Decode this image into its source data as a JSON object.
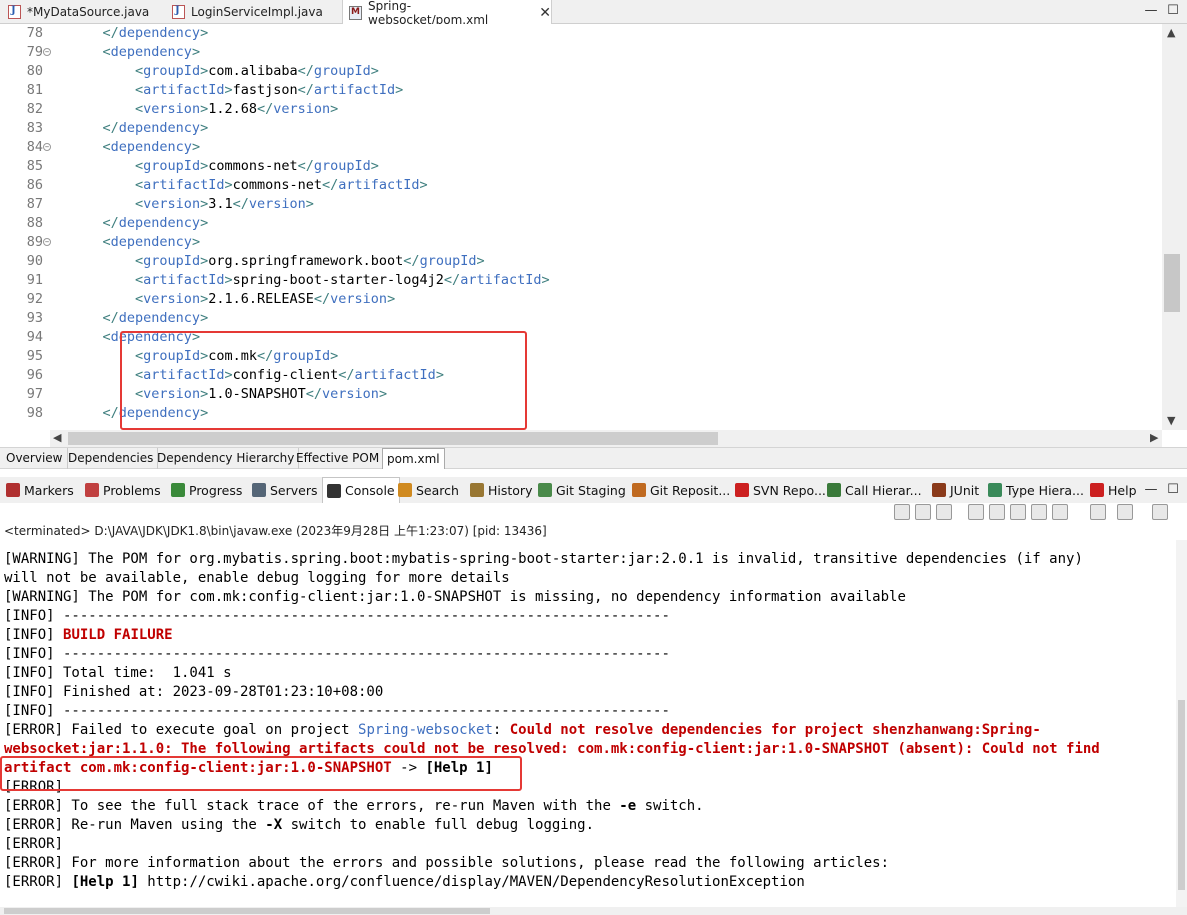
{
  "editor_tabs": [
    {
      "label": "*MyDataSource.java",
      "icon": "java-file-icon"
    },
    {
      "label": "LoginServiceImpl.java",
      "icon": "java-file-icon"
    },
    {
      "label": "Spring-websocket/pom.xml",
      "icon": "maven-pom-icon",
      "close": "✕"
    }
  ],
  "window_buttons": {
    "minimize": "—",
    "maximize": "☐"
  },
  "code_lines": [
    {
      "n": "78",
      "fold": "",
      "indent": "    ",
      "parts": [
        [
          "tag",
          "</"
        ],
        [
          "tname",
          "dependency"
        ],
        [
          "tag",
          ">"
        ]
      ]
    },
    {
      "n": "79",
      "fold": "⊖",
      "indent": "    ",
      "parts": [
        [
          "tag",
          "<"
        ],
        [
          "tname",
          "dependency"
        ],
        [
          "tag",
          ">"
        ]
      ]
    },
    {
      "n": "80",
      "fold": "",
      "indent": "        ",
      "parts": [
        [
          "tag",
          "<"
        ],
        [
          "tname",
          "groupId"
        ],
        [
          "tag",
          ">"
        ],
        [
          "txt",
          "com.alibaba"
        ],
        [
          "tag",
          "</"
        ],
        [
          "tname",
          "groupId"
        ],
        [
          "tag",
          ">"
        ]
      ]
    },
    {
      "n": "81",
      "fold": "",
      "indent": "        ",
      "parts": [
        [
          "tag",
          "<"
        ],
        [
          "tname",
          "artifactId"
        ],
        [
          "tag",
          ">"
        ],
        [
          "txt",
          "fastjson"
        ],
        [
          "tag",
          "</"
        ],
        [
          "tname",
          "artifactId"
        ],
        [
          "tag",
          ">"
        ]
      ]
    },
    {
      "n": "82",
      "fold": "",
      "indent": "        ",
      "parts": [
        [
          "tag",
          "<"
        ],
        [
          "tname",
          "version"
        ],
        [
          "tag",
          ">"
        ],
        [
          "txt",
          "1.2.68"
        ],
        [
          "tag",
          "</"
        ],
        [
          "tname",
          "version"
        ],
        [
          "tag",
          ">"
        ]
      ]
    },
    {
      "n": "83",
      "fold": "",
      "indent": "    ",
      "parts": [
        [
          "tag",
          "</"
        ],
        [
          "tname",
          "dependency"
        ],
        [
          "tag",
          ">"
        ]
      ]
    },
    {
      "n": "84",
      "fold": "⊖",
      "indent": "    ",
      "parts": [
        [
          "tag",
          "<"
        ],
        [
          "tname",
          "dependency"
        ],
        [
          "tag",
          ">"
        ]
      ]
    },
    {
      "n": "85",
      "fold": "",
      "indent": "        ",
      "parts": [
        [
          "tag",
          "<"
        ],
        [
          "tname",
          "groupId"
        ],
        [
          "tag",
          ">"
        ],
        [
          "txt",
          "commons-net"
        ],
        [
          "tag",
          "</"
        ],
        [
          "tname",
          "groupId"
        ],
        [
          "tag",
          ">"
        ]
      ]
    },
    {
      "n": "86",
      "fold": "",
      "indent": "        ",
      "parts": [
        [
          "tag",
          "<"
        ],
        [
          "tname",
          "artifactId"
        ],
        [
          "tag",
          ">"
        ],
        [
          "txt",
          "commons-net"
        ],
        [
          "tag",
          "</"
        ],
        [
          "tname",
          "artifactId"
        ],
        [
          "tag",
          ">"
        ]
      ]
    },
    {
      "n": "87",
      "fold": "",
      "indent": "        ",
      "parts": [
        [
          "tag",
          "<"
        ],
        [
          "tname",
          "version"
        ],
        [
          "tag",
          ">"
        ],
        [
          "txt",
          "3.1"
        ],
        [
          "tag",
          "</"
        ],
        [
          "tname",
          "version"
        ],
        [
          "tag",
          ">"
        ]
      ]
    },
    {
      "n": "88",
      "fold": "",
      "indent": "    ",
      "parts": [
        [
          "tag",
          "</"
        ],
        [
          "tname",
          "dependency"
        ],
        [
          "tag",
          ">"
        ]
      ]
    },
    {
      "n": "89",
      "fold": "⊖",
      "indent": "    ",
      "parts": [
        [
          "tag",
          "<"
        ],
        [
          "tname",
          "dependency"
        ],
        [
          "tag",
          ">"
        ]
      ]
    },
    {
      "n": "90",
      "fold": "",
      "indent": "        ",
      "parts": [
        [
          "tag",
          "<"
        ],
        [
          "tname",
          "groupId"
        ],
        [
          "tag",
          ">"
        ],
        [
          "txt",
          "org.springframework.boot"
        ],
        [
          "tag",
          "</"
        ],
        [
          "tname",
          "groupId"
        ],
        [
          "tag",
          ">"
        ]
      ]
    },
    {
      "n": "91",
      "fold": "",
      "indent": "        ",
      "parts": [
        [
          "tag",
          "<"
        ],
        [
          "tname",
          "artifactId"
        ],
        [
          "tag",
          ">"
        ],
        [
          "txt",
          "spring-boot-starter-log4j2"
        ],
        [
          "tag",
          "</"
        ],
        [
          "tname",
          "artifactId"
        ],
        [
          "tag",
          ">"
        ]
      ]
    },
    {
      "n": "92",
      "fold": "",
      "indent": "        ",
      "parts": [
        [
          "tag",
          "<"
        ],
        [
          "tname",
          "version"
        ],
        [
          "tag",
          ">"
        ],
        [
          "txt",
          "2.1.6.RELEASE"
        ],
        [
          "tag",
          "</"
        ],
        [
          "tname",
          "version"
        ],
        [
          "tag",
          ">"
        ]
      ]
    },
    {
      "n": "93",
      "fold": "",
      "indent": "    ",
      "parts": [
        [
          "tag",
          "</"
        ],
        [
          "tname",
          "dependency"
        ],
        [
          "tag",
          ">"
        ]
      ]
    },
    {
      "n": "94",
      "fold": "",
      "indent": "    ",
      "parts": [
        [
          "tag",
          "<"
        ],
        [
          "tname",
          "dependency"
        ],
        [
          "tag",
          ">"
        ]
      ]
    },
    {
      "n": "95",
      "fold": "",
      "indent": "        ",
      "parts": [
        [
          "tag",
          "<"
        ],
        [
          "tname",
          "groupId"
        ],
        [
          "tag",
          ">"
        ],
        [
          "txt",
          "com.mk"
        ],
        [
          "tag",
          "</"
        ],
        [
          "tname",
          "groupId"
        ],
        [
          "tag",
          ">"
        ]
      ]
    },
    {
      "n": "96",
      "fold": "",
      "indent": "        ",
      "parts": [
        [
          "tag",
          "<"
        ],
        [
          "tname",
          "artifactId"
        ],
        [
          "tag",
          ">"
        ],
        [
          "txt",
          "config-client"
        ],
        [
          "tag",
          "</"
        ],
        [
          "tname",
          "artifactId"
        ],
        [
          "tag",
          ">"
        ]
      ]
    },
    {
      "n": "97",
      "fold": "",
      "indent": "        ",
      "parts": [
        [
          "tag",
          "<"
        ],
        [
          "tname",
          "version"
        ],
        [
          "tag",
          ">"
        ],
        [
          "txt",
          "1.0-SNAPSHOT"
        ],
        [
          "tag",
          "</"
        ],
        [
          "tname",
          "version"
        ],
        [
          "tag",
          ">"
        ]
      ]
    },
    {
      "n": "98",
      "fold": "",
      "indent": "    ",
      "parts": [
        [
          "tag",
          "</"
        ],
        [
          "tname",
          "dependency"
        ],
        [
          "tag",
          ">"
        ]
      ]
    }
  ],
  "pom_tabs": [
    "Overview",
    "Dependencies",
    "Dependency Hierarchy",
    "Effective POM",
    "pom.xml"
  ],
  "view_tabs": [
    {
      "label": "Markers",
      "icon": "markers-icon",
      "color": "#b03030"
    },
    {
      "label": "Problems",
      "icon": "problems-icon",
      "color": "#c04040"
    },
    {
      "label": "Progress",
      "icon": "progress-icon",
      "color": "#3a8a3a"
    },
    {
      "label": "Servers",
      "icon": "servers-icon",
      "color": "#556677"
    },
    {
      "label": "Console",
      "icon": "console-icon",
      "color": "#333333"
    },
    {
      "label": "Search",
      "icon": "search-icon",
      "color": "#d08a20"
    },
    {
      "label": "History",
      "icon": "history-icon",
      "color": "#997733"
    },
    {
      "label": "Git Staging",
      "icon": "git-staging-icon",
      "color": "#4a8a4a"
    },
    {
      "label": "Git Reposit...",
      "icon": "git-repository-icon",
      "color": "#c06a20"
    },
    {
      "label": "SVN Repo...",
      "icon": "svn-icon",
      "color": "#cc2020"
    },
    {
      "label": "Call Hierar...",
      "icon": "call-hierarchy-icon",
      "color": "#3a7a3a"
    },
    {
      "label": "JUnit",
      "icon": "junit-icon",
      "color": "#8a3a1a"
    },
    {
      "label": "Type Hiera...",
      "icon": "type-hierarchy-icon",
      "color": "#3a8a5a"
    },
    {
      "label": "Help",
      "icon": "help-icon",
      "color": "#cc2020"
    }
  ],
  "status_line": "<terminated> D:\\JAVA\\JDK\\JDK1.8\\bin\\javaw.exe (2023年9月28日 上午1:23:07) [pid: 13436]",
  "console_lines": [
    [
      [
        "n",
        "[WARNING] The POM for org.mybatis.spring.boot:mybatis-spring-boot-starter:jar:2.0.1 is invalid, transitive dependencies (if any)"
      ]
    ],
    [
      [
        "n",
        "will not be available, enable debug logging for more details"
      ]
    ],
    [
      [
        "n",
        "[WARNING] The POM for com.mk:config-client:jar:1.0-SNAPSHOT is missing, no dependency information available"
      ]
    ],
    [
      [
        "n",
        "[INFO] ------------------------------------------------------------------------"
      ]
    ],
    [
      [
        "n",
        "[INFO] "
      ],
      [
        "err",
        "BUILD FAILURE"
      ]
    ],
    [
      [
        "n",
        "[INFO] ------------------------------------------------------------------------"
      ]
    ],
    [
      [
        "n",
        "[INFO] Total time:  1.041 s"
      ]
    ],
    [
      [
        "n",
        "[INFO] Finished at: 2023-09-28T01:23:10+08:00"
      ]
    ],
    [
      [
        "n",
        "[INFO] ------------------------------------------------------------------------"
      ]
    ],
    [
      [
        "n",
        "[ERROR] Failed to execute goal on project "
      ],
      [
        "link",
        "Spring-websocket"
      ],
      [
        "n",
        ": "
      ],
      [
        "err",
        "Could not resolve dependencies for project shenzhanwang:Spring-"
      ]
    ],
    [
      [
        "err",
        "websocket:jar:1.1.0: The following artifacts could not be resolved: com.mk:config-client:jar:1.0-SNAPSHOT (absent): Could not find"
      ]
    ],
    [
      [
        "err",
        "artifact com.mk:config-client:jar:1.0-SNAPSHOT"
      ],
      [
        "n",
        " -> "
      ],
      [
        "b",
        "[Help 1]"
      ]
    ],
    [
      [
        "n",
        "[ERROR]"
      ]
    ],
    [
      [
        "n",
        "[ERROR] To see the full stack trace of the errors, re-run Maven with the "
      ],
      [
        "b",
        "-e"
      ],
      [
        "n",
        " switch."
      ]
    ],
    [
      [
        "n",
        "[ERROR] Re-run Maven using the "
      ],
      [
        "b",
        "-X"
      ],
      [
        "n",
        " switch to enable full debug logging."
      ]
    ],
    [
      [
        "n",
        "[ERROR]"
      ]
    ],
    [
      [
        "n",
        "[ERROR] For more information about the errors and possible solutions, please read the following articles:"
      ]
    ],
    [
      [
        "n",
        "[ERROR] "
      ],
      [
        "b",
        "[Help 1]"
      ],
      [
        "n",
        " http://cwiki.apache.org/confluence/display/MAVEN/DependencyResolutionException"
      ]
    ]
  ],
  "colors": {
    "highlight": "#e53935",
    "error": "#c00000",
    "xml_tag": "#3f6fbf",
    "bracket": "#3f7f7f"
  }
}
